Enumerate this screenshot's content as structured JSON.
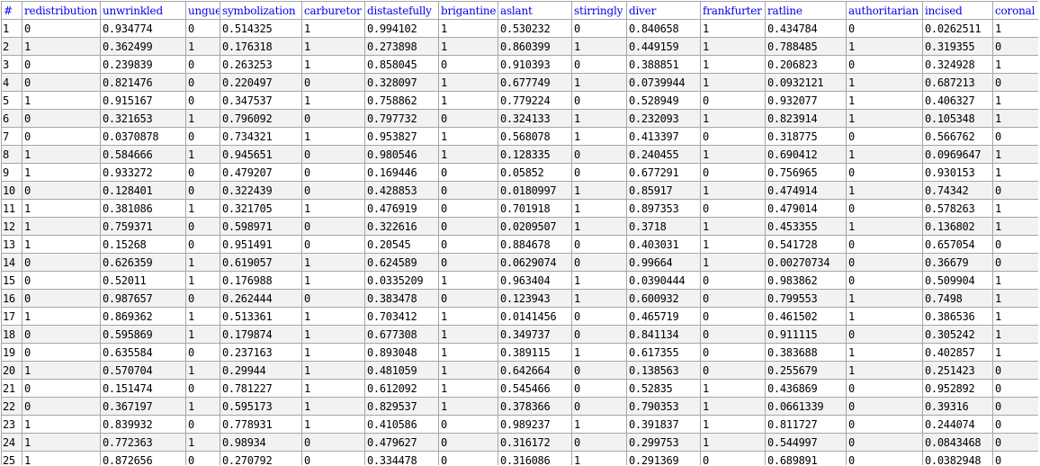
{
  "table": {
    "columns": [
      "#",
      "redistribution",
      "unwrinkled",
      "unguent",
      "symbolization",
      "carburetor",
      "distastefully",
      "brigantine",
      "aslant",
      "stirringly",
      "diver",
      "frankfurter",
      "ratline",
      "authoritarian",
      "incised",
      "coronal"
    ],
    "rows": [
      [
        "1",
        "0",
        "0.934774",
        "0",
        "0.514325",
        "1",
        "0.994102",
        "1",
        "0.530232",
        "0",
        "0.840658",
        "1",
        "0.434784",
        "0",
        "0.0262511",
        "1"
      ],
      [
        "2",
        "1",
        "0.362499",
        "1",
        "0.176318",
        "1",
        "0.273898",
        "1",
        "0.860399",
        "1",
        "0.449159",
        "1",
        "0.788485",
        "1",
        "0.319355",
        "0"
      ],
      [
        "3",
        "0",
        "0.239839",
        "0",
        "0.263253",
        "1",
        "0.858045",
        "0",
        "0.910393",
        "0",
        "0.388851",
        "1",
        "0.206823",
        "0",
        "0.324928",
        "1"
      ],
      [
        "4",
        "0",
        "0.821476",
        "0",
        "0.220497",
        "0",
        "0.328097",
        "1",
        "0.677749",
        "1",
        "0.0739944",
        "1",
        "0.0932121",
        "1",
        "0.687213",
        "0"
      ],
      [
        "5",
        "1",
        "0.915167",
        "0",
        "0.347537",
        "1",
        "0.758862",
        "1",
        "0.779224",
        "0",
        "0.528949",
        "0",
        "0.932077",
        "1",
        "0.406327",
        "1"
      ],
      [
        "6",
        "0",
        "0.321653",
        "1",
        "0.796092",
        "0",
        "0.797732",
        "0",
        "0.324133",
        "1",
        "0.232093",
        "1",
        "0.823914",
        "1",
        "0.105348",
        "1"
      ],
      [
        "7",
        "0",
        "0.0370878",
        "0",
        "0.734321",
        "1",
        "0.953827",
        "1",
        "0.568078",
        "1",
        "0.413397",
        "0",
        "0.318775",
        "0",
        "0.566762",
        "0"
      ],
      [
        "8",
        "1",
        "0.584666",
        "1",
        "0.945651",
        "0",
        "0.980546",
        "1",
        "0.128335",
        "0",
        "0.240455",
        "1",
        "0.690412",
        "1",
        "0.0969647",
        "1"
      ],
      [
        "9",
        "1",
        "0.933272",
        "0",
        "0.479207",
        "0",
        "0.169446",
        "0",
        "0.05852",
        "0",
        "0.677291",
        "0",
        "0.756965",
        "0",
        "0.930153",
        "1"
      ],
      [
        "10",
        "0",
        "0.128401",
        "0",
        "0.322439",
        "0",
        "0.428853",
        "0",
        "0.0180997",
        "1",
        "0.85917",
        "1",
        "0.474914",
        "1",
        "0.74342",
        "0"
      ],
      [
        "11",
        "1",
        "0.381086",
        "1",
        "0.321705",
        "1",
        "0.476919",
        "0",
        "0.701918",
        "1",
        "0.897353",
        "0",
        "0.479014",
        "0",
        "0.578263",
        "1"
      ],
      [
        "12",
        "1",
        "0.759371",
        "0",
        "0.598971",
        "0",
        "0.322616",
        "0",
        "0.0209507",
        "1",
        "0.3718",
        "1",
        "0.453355",
        "1",
        "0.136802",
        "1"
      ],
      [
        "13",
        "1",
        "0.15268",
        "0",
        "0.951491",
        "0",
        "0.20545",
        "0",
        "0.884678",
        "0",
        "0.403031",
        "1",
        "0.541728",
        "0",
        "0.657054",
        "0"
      ],
      [
        "14",
        "0",
        "0.626359",
        "1",
        "0.619057",
        "1",
        "0.624589",
        "0",
        "0.0629074",
        "0",
        "0.99664",
        "1",
        "0.00270734",
        "0",
        "0.36679",
        "0"
      ],
      [
        "15",
        "0",
        "0.52011",
        "1",
        "0.176988",
        "1",
        "0.0335209",
        "1",
        "0.963404",
        "1",
        "0.0390444",
        "0",
        "0.983862",
        "0",
        "0.509904",
        "1"
      ],
      [
        "16",
        "0",
        "0.987657",
        "0",
        "0.262444",
        "0",
        "0.383478",
        "0",
        "0.123943",
        "1",
        "0.600932",
        "0",
        "0.799553",
        "1",
        "0.7498",
        "1"
      ],
      [
        "17",
        "1",
        "0.869362",
        "1",
        "0.513361",
        "1",
        "0.703412",
        "1",
        "0.0141456",
        "0",
        "0.465719",
        "0",
        "0.461502",
        "1",
        "0.386536",
        "1"
      ],
      [
        "18",
        "0",
        "0.595869",
        "1",
        "0.179874",
        "1",
        "0.677308",
        "1",
        "0.349737",
        "0",
        "0.841134",
        "0",
        "0.911115",
        "0",
        "0.305242",
        "1"
      ],
      [
        "19",
        "0",
        "0.635584",
        "0",
        "0.237163",
        "1",
        "0.893048",
        "1",
        "0.389115",
        "1",
        "0.617355",
        "0",
        "0.383688",
        "1",
        "0.402857",
        "1"
      ],
      [
        "20",
        "1",
        "0.570704",
        "1",
        "0.29944",
        "1",
        "0.481059",
        "1",
        "0.642664",
        "0",
        "0.138563",
        "0",
        "0.255679",
        "1",
        "0.251423",
        "0"
      ],
      [
        "21",
        "0",
        "0.151474",
        "0",
        "0.781227",
        "1",
        "0.612092",
        "1",
        "0.545466",
        "0",
        "0.52835",
        "1",
        "0.436869",
        "0",
        "0.952892",
        "0"
      ],
      [
        "22",
        "0",
        "0.367197",
        "1",
        "0.595173",
        "1",
        "0.829537",
        "1",
        "0.378366",
        "0",
        "0.790353",
        "1",
        "0.0661339",
        "0",
        "0.39316",
        "0"
      ],
      [
        "23",
        "1",
        "0.839932",
        "0",
        "0.778931",
        "1",
        "0.410586",
        "0",
        "0.989237",
        "1",
        "0.391837",
        "1",
        "0.811727",
        "0",
        "0.244074",
        "0"
      ],
      [
        "24",
        "1",
        "0.772363",
        "1",
        "0.98934",
        "0",
        "0.479627",
        "0",
        "0.316172",
        "0",
        "0.299753",
        "1",
        "0.544997",
        "0",
        "0.0843468",
        "0"
      ],
      [
        "25",
        "1",
        "0.872656",
        "0",
        "0.270792",
        "0",
        "0.334478",
        "0",
        "0.316086",
        "1",
        "0.291369",
        "0",
        "0.689891",
        "0",
        "0.0382948",
        "0"
      ]
    ]
  }
}
